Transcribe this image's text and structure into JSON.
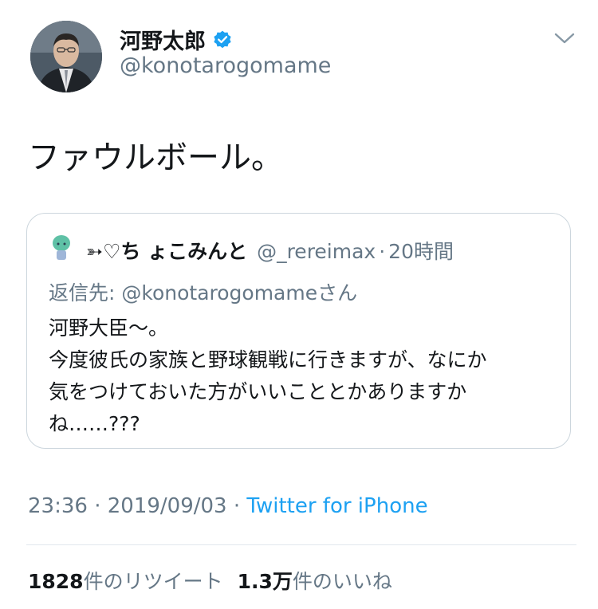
{
  "author": {
    "display_name": "河野太郎",
    "handle": "@konotarogomame",
    "verified": true
  },
  "tweet": {
    "text": "ファウルボール。",
    "time": "23:36",
    "date": "2019/09/03",
    "separator": "·",
    "source": "Twitter for iPhone"
  },
  "quoted": {
    "display_name": "➳♡ち ょこみんと",
    "handle": "@_rereimax",
    "age": "20時間",
    "reply_prefix": "返信先: ",
    "reply_handle": "@konotarogomame",
    "reply_suffix": "さん",
    "lines": [
      "河野大臣〜。",
      "今度彼氏の家族と野球観戦に行きますが、なにか",
      "気をつけておいた方がいいこととかありますか",
      "ね……???"
    ]
  },
  "stats": {
    "retweets_count": "1828",
    "retweets_label": "件のリツイート",
    "likes_count": "1.3万",
    "likes_label": "件のいいね"
  },
  "colors": {
    "text": "#14171a",
    "secondary": "#657786",
    "accent": "#1da1f2",
    "border": "#ccd6dd"
  },
  "icons": {
    "verified": "verified-badge-icon",
    "menu": "chevron-down-icon"
  }
}
